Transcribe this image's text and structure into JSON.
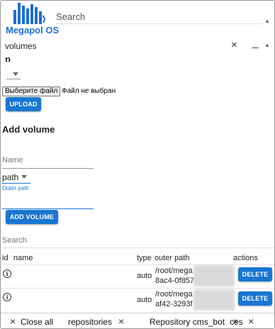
{
  "topbar": {
    "app_name": "Megapol OS",
    "search_placeholder": "Search",
    "logo_color": "#1e6fd0"
  },
  "window": {
    "title": "volumes",
    "close_icon": "×",
    "minimize_icon": "_"
  },
  "upload": {
    "partial_heading": "p",
    "file_button_label": "Выберите файл",
    "file_status": "Файл не выбран",
    "upload_label": "UPLOAD"
  },
  "add_volume": {
    "title": "Add volume",
    "name_placeholder": "Name",
    "path_type_value": "path",
    "outer_path_label": "Outer path",
    "add_label": "ADD VOLUME"
  },
  "table": {
    "search_placeholder": "Search",
    "headers": {
      "id": "id",
      "name": "name",
      "type": "type",
      "outer_path": "outer path",
      "actions": "actions"
    },
    "rows": [
      {
        "type": "auto",
        "path_line1": "/root/mega",
        "path_line2": "8ac4-0f857",
        "delete_label": "DELETE"
      },
      {
        "type": "auto",
        "path_line1": "/root/mega",
        "path_line2": "af42-3293f",
        "delete_label": "DELETE"
      }
    ]
  },
  "tabs": [
    {
      "label": "Close all",
      "icon": "×"
    },
    {
      "label": "repositories",
      "icon": "×"
    },
    {
      "label": "Repository cms_bot",
      "icon": "×"
    },
    {
      "label": "ces",
      "icon": "×"
    }
  ],
  "colors": {
    "accent": "#1976d2"
  }
}
